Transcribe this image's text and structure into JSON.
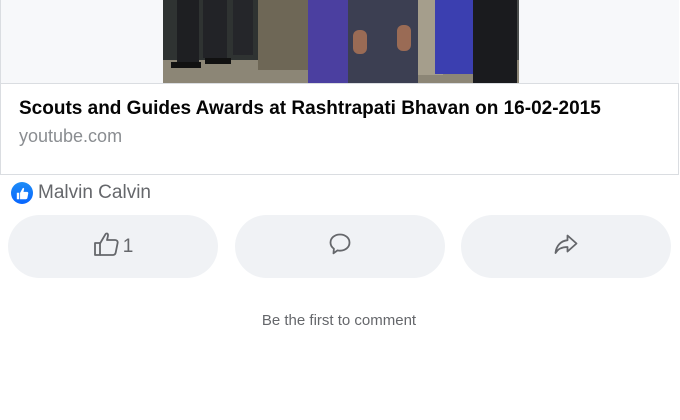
{
  "link_preview": {
    "title": "Scouts and Guides Awards at Rashtrapati Bhavan on 16-02-2015",
    "domain": "youtube.com",
    "thumbnail_icon": "video-thumbnail"
  },
  "reactions": {
    "icon": "like-reaction-icon",
    "reactor_name": "Malvin Calvin",
    "color": "#0866ff"
  },
  "actions": {
    "like": {
      "icon": "thumbs-up-icon",
      "count": "1"
    },
    "comment": {
      "icon": "speech-bubble-icon"
    },
    "share": {
      "icon": "share-arrow-icon"
    }
  },
  "comments": {
    "empty_text": "Be the first to comment"
  },
  "colors": {
    "button_bg": "#f0f2f5",
    "secondary_text": "#65676b",
    "primary_text": "#050505",
    "divider": "#dadde1"
  }
}
